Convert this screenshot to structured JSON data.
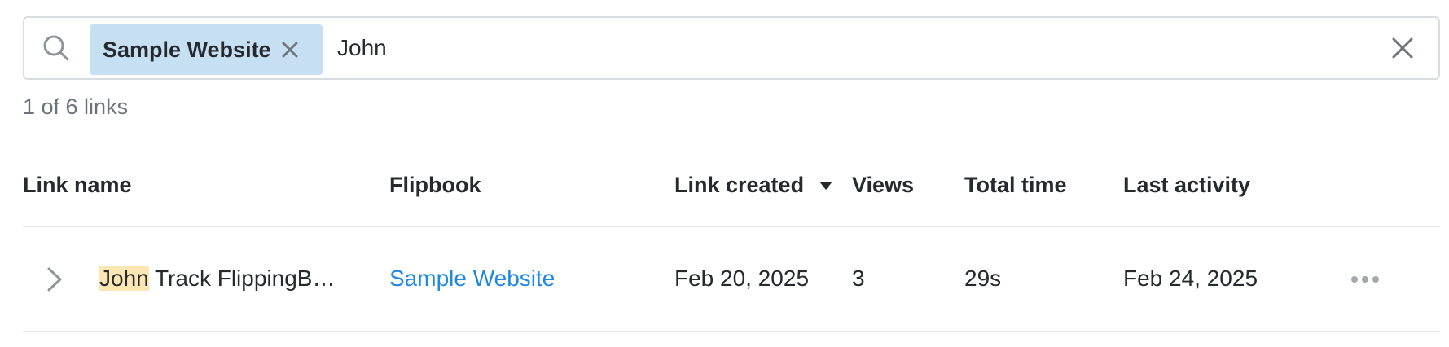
{
  "search": {
    "filter_chip": "Sample Website",
    "value": "John",
    "placeholder": ""
  },
  "results": {
    "count_label": "1 of 6 links"
  },
  "table": {
    "columns": [
      "Link name",
      "Flipbook",
      "Link created",
      "Views",
      "Total time",
      "Last activity"
    ],
    "sorted_column": "Link created",
    "sort_direction": "descending",
    "rows": [
      {
        "highlight": "John",
        "name_rest": " Track FlippingBook Publisher",
        "flipbook": "Sample Website",
        "link_created": "Feb 20, 2025",
        "views": "3",
        "total_time": "29s",
        "last_activity": "Feb 24, 2025"
      }
    ]
  },
  "colors": {
    "chip_bg": "#c6dff2",
    "link": "#1e88e5",
    "highlight": "#fbe6b4",
    "muted_text": "#6c737a"
  },
  "icons": [
    "search-icon",
    "close-icon",
    "clear-icon",
    "sort-down-icon",
    "chevron-right-icon",
    "more-horizontal-icon"
  ]
}
